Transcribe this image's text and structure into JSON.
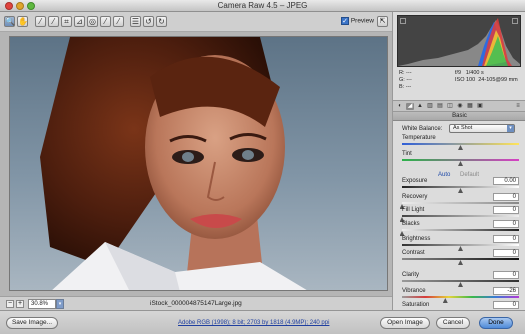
{
  "window": {
    "title": "Camera Raw 4.5  –  JPEG"
  },
  "toolbar": {
    "tools": [
      {
        "name": "zoom-tool",
        "glyph": "🔍",
        "active": true
      },
      {
        "name": "hand-tool",
        "glyph": "✋",
        "active": false
      },
      {
        "name": "white-balance-tool",
        "glyph": "⁄",
        "active": false
      },
      {
        "name": "color-sampler-tool",
        "glyph": "⁄",
        "active": false
      },
      {
        "name": "crop-tool",
        "glyph": "⌗",
        "active": false
      },
      {
        "name": "straighten-tool",
        "glyph": "⊿",
        "active": false
      },
      {
        "name": "red-eye-tool",
        "glyph": "◎",
        "active": false
      },
      {
        "name": "spot-removal-tool",
        "glyph": "⁄",
        "active": false
      },
      {
        "name": "adjustment-brush-tool",
        "glyph": "⁄",
        "active": false
      },
      {
        "name": "preferences-tool",
        "glyph": "☰",
        "active": false
      },
      {
        "name": "rotate-left-tool",
        "glyph": "↺",
        "active": false
      },
      {
        "name": "rotate-right-tool",
        "glyph": "↻",
        "active": false
      }
    ],
    "preview_label": "Preview",
    "preview_checked": true,
    "fullscreen_glyph": "⇱"
  },
  "status": {
    "zoom_out_glyph": "−",
    "zoom_in_glyph": "+",
    "zoom_value": "30.8%",
    "filename": "iStock_000004875147Large.jpg"
  },
  "readout": {
    "r_label": "R:",
    "r_value": "---",
    "g_label": "G:",
    "g_value": "---",
    "b_label": "B:",
    "b_value": "---",
    "aperture": "f/9",
    "shutter": "1/400 s",
    "iso": "ISO 100",
    "lens": "24-105@99 mm"
  },
  "panel": {
    "section_title": "Basic",
    "white_balance_label": "White Balance:",
    "white_balance_value": "As Shot",
    "auto_label": "Auto",
    "default_label": "Default"
  },
  "sliders": [
    {
      "label": "Temperature",
      "value": "",
      "level": 0.5,
      "track": "linear-gradient(90deg,#2f5fd8,#ffe45a)"
    },
    {
      "label": "Tint",
      "value": "",
      "level": 0.5,
      "track": "linear-gradient(90deg,#2cb24a,#d640c4)"
    },
    {
      "label": "Exposure",
      "value": "0.00",
      "level": 0.5,
      "track": "linear-gradient(90deg,#222,#fff)"
    },
    {
      "label": "Recovery",
      "value": "0",
      "level": 0.0,
      "track": "linear-gradient(90deg,#eee,#888)"
    },
    {
      "label": "Fill Light",
      "value": "0",
      "level": 0.0,
      "track": "linear-gradient(90deg,#444,#eee)"
    },
    {
      "label": "Blacks",
      "value": "0",
      "level": 0.0,
      "track": "linear-gradient(90deg,#eee,#222)"
    },
    {
      "label": "Brightness",
      "value": "0",
      "level": 0.5,
      "track": "linear-gradient(90deg,#333,#fff)"
    },
    {
      "label": "Contrast",
      "value": "0",
      "level": 0.5,
      "track": "linear-gradient(90deg,#888,#111)"
    },
    {
      "label": "Clarity",
      "value": "0",
      "level": 0.5,
      "track": "linear-gradient(90deg,#999,#333)"
    },
    {
      "label": "Vibrance",
      "value": "-26",
      "level": 0.37,
      "track": "linear-gradient(90deg,#9a9a9a,#d63a3a,#e6d43a,#3ab84a,#3a7ad6,#b43ad6)"
    },
    {
      "label": "Saturation",
      "value": "0",
      "level": 0.5,
      "track": "linear-gradient(90deg,#9a9a9a,#d63a3a,#e6d43a,#3ab84a,#3a7ad6,#b43ad6)"
    }
  ],
  "bottom": {
    "save_label": "Save Image...",
    "workflow_text": "Adobe RGB (1998); 8 bit; 2703 by 1818 (4.9MP); 240 ppi",
    "open_label": "Open Image",
    "cancel_label": "Cancel",
    "done_label": "Done"
  }
}
